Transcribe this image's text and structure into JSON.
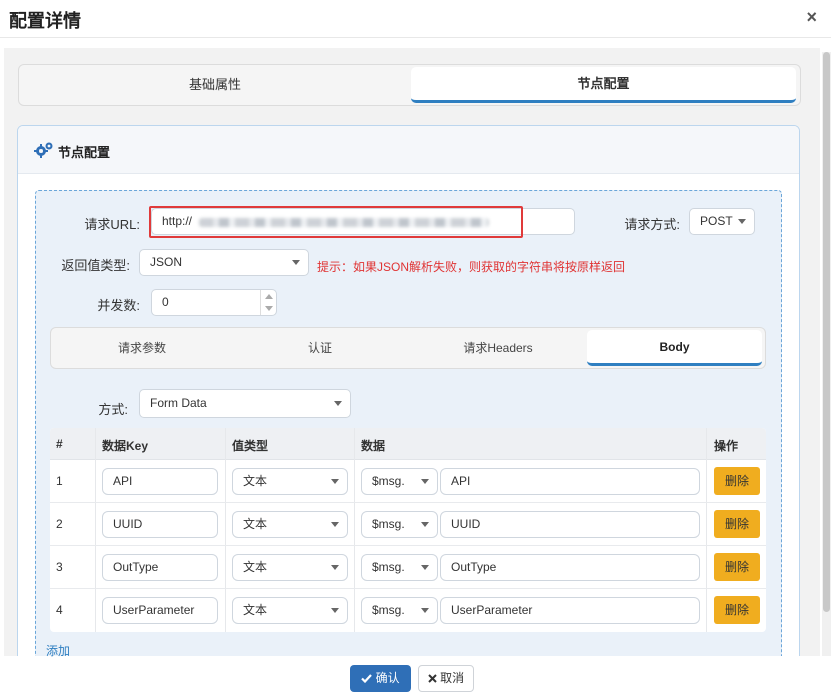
{
  "dialog": {
    "title": "配置详情",
    "close": "×"
  },
  "top_tabs": [
    {
      "label": "基础属性"
    },
    {
      "label": "节点配置"
    }
  ],
  "panel": {
    "title": "节点配置",
    "icon": "gears-icon"
  },
  "form": {
    "url_label": "请求URL:",
    "url_value": "http://",
    "method_label": "请求方式:",
    "method_value": "POST",
    "return_label": "返回值类型:",
    "return_value": "JSON",
    "hint": "提示：如果JSON解析失败，则获取的字符串将按原样返回",
    "concurrency_label": "并发数:",
    "concurrency_value": "0"
  },
  "sub_tabs": [
    {
      "label": "请求参数"
    },
    {
      "label": "认证"
    },
    {
      "label": "请求Headers"
    },
    {
      "label": "Body"
    }
  ],
  "body": {
    "mode_label": "方式:",
    "mode_value": "Form Data",
    "columns": [
      "#",
      "数据Key",
      "值类型",
      "数据",
      "操作"
    ],
    "rows": [
      {
        "num": "1",
        "key": "API",
        "type": "文本",
        "prefix": "$msg.",
        "data": "API",
        "action": "删除"
      },
      {
        "num": "2",
        "key": "UUID",
        "type": "文本",
        "prefix": "$msg.",
        "data": "UUID",
        "action": "删除"
      },
      {
        "num": "3",
        "key": "OutType",
        "type": "文本",
        "prefix": "$msg.",
        "data": "OutType",
        "action": "删除"
      },
      {
        "num": "4",
        "key": "UserParameter",
        "type": "文本",
        "prefix": "$msg.",
        "data": "UserParameter",
        "action": "删除"
      }
    ],
    "add_label": "添加"
  },
  "footer": {
    "ok_label": "确认",
    "cancel_label": "取消",
    "ok_icon": "check-icon",
    "cancel_icon": "x-icon"
  },
  "colors": {
    "accent": "#2f7fc1",
    "primary_button": "#2f6fb7",
    "delete_button": "#f0ad1f",
    "hint": "#e03434"
  }
}
